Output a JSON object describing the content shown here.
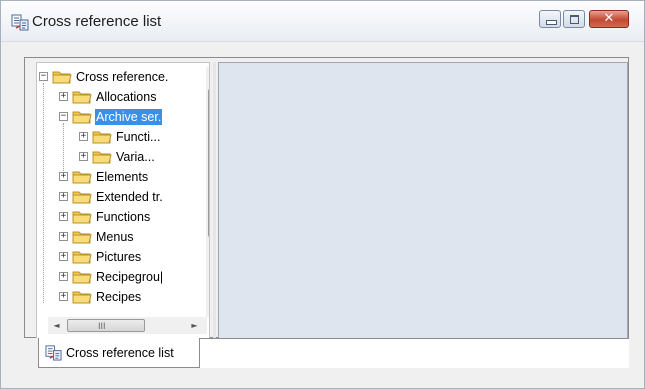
{
  "window": {
    "title": "Cross reference list",
    "controls": {
      "minimize": "minimize",
      "maximize": "maximize",
      "close": "✕"
    }
  },
  "tree": {
    "items": [
      {
        "label": "Cross reference.",
        "expander": "−",
        "level": 0,
        "selected": false
      },
      {
        "label": "Allocations",
        "expander": "+",
        "level": 1,
        "selected": false
      },
      {
        "label": "Archive ser.",
        "expander": "−",
        "level": 1,
        "selected": true
      },
      {
        "label": "Functi...",
        "expander": "+",
        "level": 2,
        "selected": false
      },
      {
        "label": "Varia...",
        "expander": "+",
        "level": 2,
        "selected": false
      },
      {
        "label": "Elements",
        "expander": "+",
        "level": 1,
        "selected": false
      },
      {
        "label": "Extended tr.",
        "expander": "+",
        "level": 1,
        "selected": false
      },
      {
        "label": "Functions",
        "expander": "+",
        "level": 1,
        "selected": false
      },
      {
        "label": "Menus",
        "expander": "+",
        "level": 1,
        "selected": false
      },
      {
        "label": "Pictures",
        "expander": "+",
        "level": 1,
        "selected": false
      },
      {
        "label": "Recipegrou|",
        "expander": "+",
        "level": 1,
        "selected": false
      },
      {
        "label": "Recipes",
        "expander": "+",
        "level": 1,
        "selected": false
      }
    ]
  },
  "scrollbars": {
    "vertical": {
      "up": "▲",
      "down": "▼",
      "grip": "≡"
    },
    "horizontal": {
      "left": "◄",
      "right": "►",
      "grip": "III"
    }
  },
  "tabs": [
    {
      "label": "Cross reference list",
      "active": true
    }
  ],
  "colors": {
    "selection": "#3a8fe6",
    "right_pane": "#dee5ef",
    "folder": "#f2c94c",
    "close_button": "#c24a34"
  },
  "icons": {
    "app": "cross-reference-icon",
    "folder": "folder-icon"
  }
}
